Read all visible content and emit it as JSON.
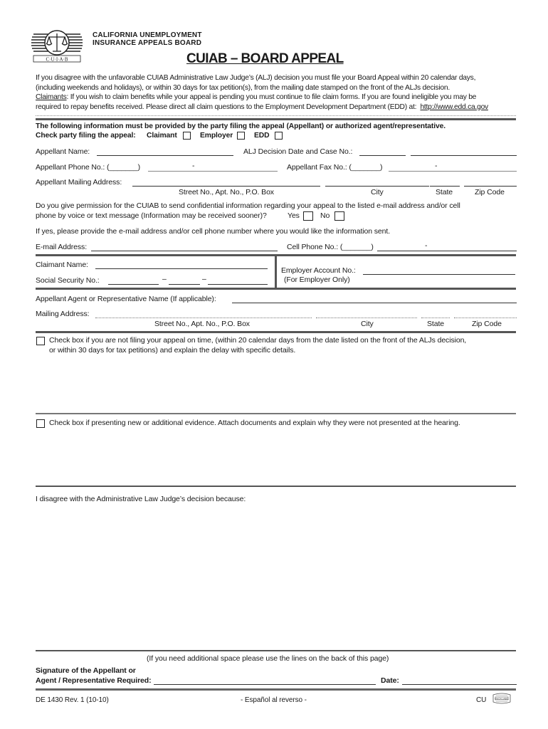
{
  "header": {
    "agency_line1": "CALIFORNIA UNEMPLOYMENT",
    "agency_line2": "INSURANCE APPEALS BOARD",
    "logo_caption": "C·U·I·A·B",
    "title": "CUIAB – BOARD APPEAL"
  },
  "intro": {
    "line1": "If you disagree with the unfavorable CUIAB Administrative Law Judge’s (ALJ) decision you must file your Board Appeal within 20 calendar days,",
    "line2": "(including weekends and holidays), or within 30 days for tax petition(s), from the mailing date stamped on the front of the ALJs decision.",
    "claimants_label": "Claimants",
    "line3_rest": ":  If you wish to claim benefits while your appeal is pending you must continue to file claim forms. If you are found ineligible you may be",
    "line4": "required to repay benefits received. Please direct all claim questions to the Employment Development Department (EDD) at:",
    "edd_link": "http://www.edd.ca.gov"
  },
  "party": {
    "notice": "The following information must be provided by the party filing the appeal (Appellant) or authorized agent/representative.",
    "check_label": "Check party filing the appeal:",
    "options": [
      {
        "label": "Claimant",
        "checked": false
      },
      {
        "label": "Employer",
        "checked": false
      },
      {
        "label": "EDD",
        "checked": false
      }
    ]
  },
  "appellant": {
    "name_label": "Appellant Name:",
    "name_value": "",
    "alj_label": "ALJ Decision Date and Case No.:",
    "alj_date_value": "",
    "case_no_value": "",
    "phone_label": "Appellant Phone No.: (_______)",
    "phone_dash": "-",
    "phone_value": "",
    "fax_label": "Appellant Fax No.: (_______)",
    "fax_dash": "-",
    "fax_value": "",
    "address_label": "Appellant Mailing Address:",
    "address_value": "",
    "street_caption": "Street No., Apt. No., P.O. Box",
    "city_caption": "City",
    "state_caption": "State",
    "zip_caption": "Zip Code"
  },
  "permission": {
    "line1": "Do you give permission for the CUIAB to send confidential information regarding your appeal to the listed e-mail address and/or cell",
    "line2": "phone by voice or text message (Information may be received sooner)?",
    "yes_label": "Yes",
    "no_label": "No",
    "yes_checked": false,
    "no_checked": false,
    "ifyes": "If yes, please provide the e-mail address and/or cell phone number where you would like the information sent.",
    "email_label": "E-mail Address:",
    "email_value": "",
    "cell_label": "Cell Phone No.: (_______)",
    "cell_dash": "-",
    "cell_value": ""
  },
  "claimant": {
    "name_label": "Claimant Name:",
    "name_value": "",
    "ssn_label": "Social Security No.:",
    "ssn_sep1": "–",
    "ssn_sep2": "–",
    "employer_acct_label": "Employer Account No.:",
    "employer_acct_note": "(For Employer Only)",
    "employer_acct_value": ""
  },
  "agent": {
    "name_label": "Appellant Agent or Representative Name (If applicable):",
    "name_value": "",
    "address_label": "Mailing Address:",
    "address_value": "",
    "street_caption": "Street No., Apt. No., P.O. Box",
    "city_caption": "City",
    "state_caption": "State",
    "zip_caption": "Zip Code"
  },
  "late": {
    "line1": "Check box if you are not filing your appeal on time, (within 20 calendar days from the date listed on the front of the ALJs decision,",
    "line2": "or within 30 days for tax petitions) and explain the delay with specific details.",
    "checked": false,
    "explanation": ""
  },
  "evidence": {
    "text": "Check box if presenting new or additional evidence. Attach documents and explain why they were not presented at the hearing.",
    "checked": false,
    "explanation": ""
  },
  "disagree": {
    "label": "I disagree with the Administrative Law Judge’s decision because:",
    "value": ""
  },
  "signature": {
    "space_note": "(If you need additional space please use the lines on the back of this page)",
    "label_line1": "Signature of the Appellant or",
    "label_line2": "Agent / Representative Required:",
    "date_label": "Date:",
    "signature_value": "",
    "date_value": ""
  },
  "footer": {
    "form_id": "DE 1430 Rev. 1 (10-10)",
    "spanish_note": "- Español al reverso -",
    "code": "CU",
    "union_label": "UNION LABEL"
  }
}
